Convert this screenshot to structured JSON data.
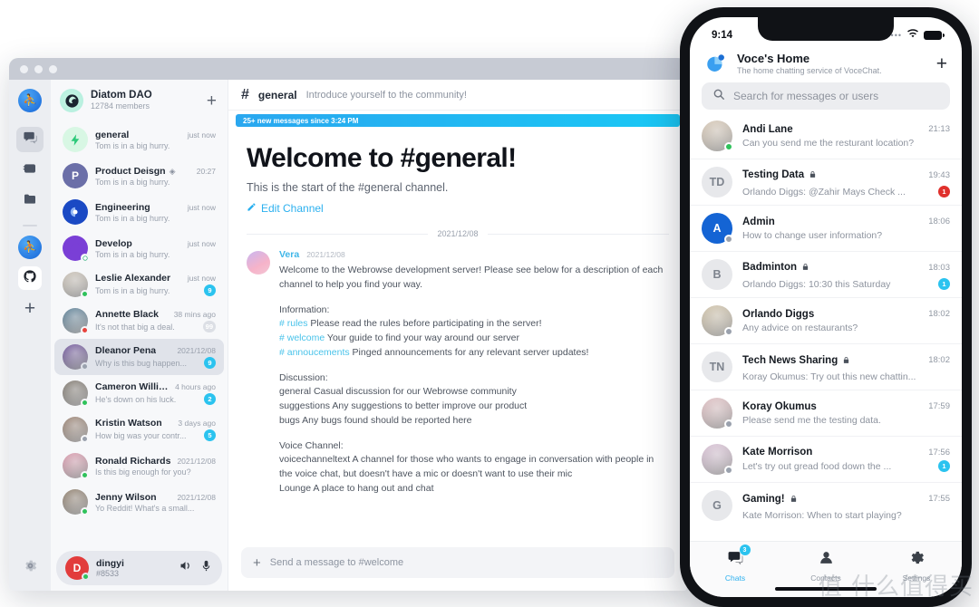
{
  "desktop": {
    "window_controls": [
      "close",
      "minimize",
      "maximize"
    ],
    "rail": {
      "items": [
        {
          "name": "workspace-logo",
          "icon": "people-logo-icon"
        },
        {
          "name": "chats",
          "icon": "chat-bubble-icon",
          "active": true
        },
        {
          "name": "contacts",
          "icon": "contact-card-icon",
          "active": false
        },
        {
          "name": "files",
          "icon": "folder-icon",
          "active": false
        },
        {
          "name": "workspace-diatom",
          "icon": "people-logo-icon",
          "active": false
        },
        {
          "name": "github",
          "icon": "github-icon",
          "active": false
        },
        {
          "name": "add-workspace",
          "icon": "plus-icon",
          "active": false
        }
      ],
      "settings_label": "Settings",
      "settings_icon": "gear-icon"
    },
    "sidebar": {
      "workspace_name": "Diatom DAO",
      "workspace_members": "12784 members",
      "add_icon": "plus-icon",
      "items": [
        {
          "name": "general",
          "time": "just now",
          "preview": "Tom is in a big hurry.",
          "avatar_type": "bolt",
          "avatar_text": "",
          "avatar_color": "#d8f7e4",
          "status": "",
          "badge": "",
          "badge_muted": false,
          "verified": false
        },
        {
          "name": "Product Deisgn",
          "time": "20:27",
          "preview": "Tom is in a big hurry.",
          "avatar_type": "letter",
          "avatar_text": "P",
          "avatar_color": "#6b6fa8",
          "status": "",
          "badge": "",
          "badge_muted": false,
          "verified": true
        },
        {
          "name": "Engineering",
          "time": "just now",
          "preview": "Tom is in a big hurry.",
          "avatar_type": "ring",
          "avatar_text": "",
          "avatar_color": "#1a49c4",
          "status": "",
          "badge": "",
          "badge_muted": false,
          "verified": false
        },
        {
          "name": "Develop",
          "time": "just now",
          "preview": "Tom is in a big hurry.",
          "avatar_type": "leaf",
          "avatar_text": "",
          "avatar_color": "#7a3fd6",
          "status": "ring",
          "badge": "",
          "badge_muted": false,
          "verified": false
        },
        {
          "name": "Leslie Alexander",
          "time": "just now",
          "preview": "Tom is in a big hurry.",
          "avatar_type": "photo",
          "avatar_text": "",
          "avatar_color": "#c3b9ab",
          "status": "online",
          "badge": "9",
          "badge_muted": false,
          "verified": false
        },
        {
          "name": "Annette Black",
          "time": "38 mins ago",
          "preview": "It's not that big a deal.",
          "avatar_type": "photo",
          "avatar_text": "",
          "avatar_color": "#3e6a86",
          "status": "busy",
          "badge": "99",
          "badge_muted": true,
          "verified": false
        },
        {
          "name": "Dleanor Pena",
          "time": "2021/12/08",
          "preview": "Why is this bug happen...",
          "avatar_type": "photo",
          "avatar_text": "",
          "avatar_color": "#5a3a8e",
          "status": "away",
          "badge": "9",
          "badge_muted": false,
          "verified": false,
          "selected": true
        },
        {
          "name": "Cameron Willia...",
          "time": "4 hours ago",
          "preview": "He's down on his luck.",
          "avatar_type": "photo",
          "avatar_text": "",
          "avatar_color": "#6b6257",
          "status": "online",
          "badge": "2",
          "badge_muted": false,
          "verified": false
        },
        {
          "name": "Kristin Watson",
          "time": "3 days ago",
          "preview": "How big was your contr...",
          "avatar_type": "photo",
          "avatar_text": "",
          "avatar_color": "#8a6d5a",
          "status": "away",
          "badge": "5",
          "badge_muted": false,
          "verified": false
        },
        {
          "name": "Ronald Richards",
          "time": "2021/12/08",
          "preview": "Is this big enough for you?",
          "avatar_type": "photo",
          "avatar_text": "",
          "avatar_color": "#d88ba2",
          "status": "online",
          "badge": "",
          "badge_muted": false,
          "verified": false
        },
        {
          "name": "Jenny Wilson",
          "time": "2021/12/08",
          "preview": "Yo Reddit! What's a small...",
          "avatar_type": "photo",
          "avatar_text": "",
          "avatar_color": "#7e6a55",
          "status": "online",
          "badge": "",
          "badge_muted": false,
          "verified": false
        }
      ],
      "current_user": {
        "name": "dingyi",
        "tag": "#8533",
        "avatar_text": "D",
        "status": "online",
        "speaker_icon": "speaker-icon",
        "mic_icon": "microphone-icon"
      }
    },
    "chat": {
      "hash_icon": "hash-icon",
      "channel_name": "general",
      "channel_topic": "Introduce yourself to the community!",
      "new_messages_banner": "25+ new messages since 3:24 PM",
      "welcome_heading": "Welcome to #general!",
      "welcome_subtitle": "This is the start of the #general channel.",
      "edit_channel_label": "Edit Channel",
      "edit_icon": "pencil-icon",
      "date_separator": "2021/12/08",
      "message": {
        "author": "Vera",
        "timestamp": "2021/12/08",
        "paragraph1": "Welcome to the Webrowse development server! Please see below for a description of each channel to help you find your way.",
        "info_heading": "Information:",
        "info_lines": [
          {
            "channel": "# rules",
            "text": "Please read the rules before participating in the server!"
          },
          {
            "channel": "# welcome",
            "text": "Your guide to find your way around our server"
          },
          {
            "channel": "# annoucements",
            "text": "Pinged announcements for any relevant server updates!"
          }
        ],
        "discussion_heading": "Discussion:",
        "discussion_lines": [
          "general Casual discussion for our Webrowse community",
          "suggestions Any suggestions to better improve our product",
          "bugs Any bugs found should be reported here"
        ],
        "voice_heading": "Voice Channel:",
        "voice_lines": [
          "voicechanneltext A channel for those who wants to engage in conversation with people in the voice chat, but doesn't have a mic or doesn't want to use their mic",
          "Lounge A place to hang out and chat"
        ]
      },
      "composer": {
        "plus_icon": "plus-icon",
        "placeholder": "Send a message to #welcome"
      }
    }
  },
  "phone": {
    "statusbar": {
      "time": "9:14",
      "signal_icon": "signal-dots-icon",
      "wifi_icon": "wifi-icon",
      "battery_icon": "battery-icon"
    },
    "header": {
      "logo_icon": "vocechat-logo-icon",
      "title": "Voce's Home",
      "subtitle": "The home chatting service of VoceChat.",
      "add_icon": "plus-icon"
    },
    "search": {
      "icon": "search-icon",
      "placeholder": "Search for messages or users"
    },
    "conversations": [
      {
        "name": "Andi Lane",
        "time": "21:13",
        "preview": "Can you send me the resturant location?",
        "avatar_type": "photo",
        "avatar_text": "",
        "avatar_color": "#d6c4ae",
        "status": "online",
        "badge": "",
        "badge_color": "",
        "locked": false
      },
      {
        "name": "Testing Data",
        "time": "19:43",
        "preview": "Orlando Diggs:  @Zahir Mays Check ...",
        "avatar_type": "letter",
        "avatar_text": "TD",
        "avatar_color": "#e7e8eb",
        "status": "",
        "badge": "1",
        "badge_color": "red",
        "locked": true
      },
      {
        "name": "Admin",
        "time": "18:06",
        "preview": "How to change user information?",
        "avatar_type": "letter",
        "avatar_text": "A",
        "avatar_color": "#1464d4",
        "status": "away",
        "badge": "",
        "badge_color": "",
        "locked": false
      },
      {
        "name": "Badminton",
        "time": "18:03",
        "preview": "Orlando Diggs: 10:30 this Saturday",
        "avatar_type": "letter",
        "avatar_text": "B",
        "avatar_color": "#e7e8eb",
        "status": "",
        "badge": "1",
        "badge_color": "cyan",
        "locked": true
      },
      {
        "name": "Orlando Diggs",
        "time": "18:02",
        "preview": "Any advice on restaurants?",
        "avatar_type": "photo",
        "avatar_text": "",
        "avatar_color": "#cdbd9e",
        "status": "away",
        "badge": "",
        "badge_color": "",
        "locked": false
      },
      {
        "name": "Tech News Sharing",
        "time": "18:02",
        "preview": "Koray Okumus: Try out this new chattin...",
        "avatar_type": "letter",
        "avatar_text": "TN",
        "avatar_color": "#e7e8eb",
        "status": "",
        "badge": "",
        "badge_color": "",
        "locked": true
      },
      {
        "name": "Koray Okumus",
        "time": "17:59",
        "preview": "Please send me the testing data.",
        "avatar_type": "photo",
        "avatar_text": "",
        "avatar_color": "#e0b9bd",
        "status": "away",
        "badge": "",
        "badge_color": "",
        "locked": false
      },
      {
        "name": "Kate Morrison",
        "time": "17:56",
        "preview": "Let's try out gread food down the ...",
        "avatar_type": "photo",
        "avatar_text": "",
        "avatar_color": "#d9bcd4",
        "status": "away",
        "badge": "1",
        "badge_color": "cyan",
        "locked": false
      },
      {
        "name": "Gaming!",
        "time": "17:55",
        "preview": "Kate Morrison: When to start playing?",
        "avatar_type": "letter",
        "avatar_text": "G",
        "avatar_color": "#e7e8eb",
        "status": "",
        "badge": "",
        "badge_color": "",
        "locked": true
      }
    ],
    "tabbar": [
      {
        "label": "Chats",
        "icon": "chat-bubble-icon",
        "badge": "3",
        "active": true
      },
      {
        "label": "Contacts",
        "icon": "person-icon",
        "badge": "",
        "active": false
      },
      {
        "label": "Settings",
        "icon": "gear-icon",
        "badge": "",
        "active": false
      }
    ]
  },
  "watermark": "值 什么值得买",
  "colors": {
    "accent": "#2bb0ef",
    "badge": "#2bc3ef",
    "badge_red": "#e0302c",
    "online": "#2fc25b",
    "busy": "#e8423c",
    "away": "#9aa1ad"
  }
}
